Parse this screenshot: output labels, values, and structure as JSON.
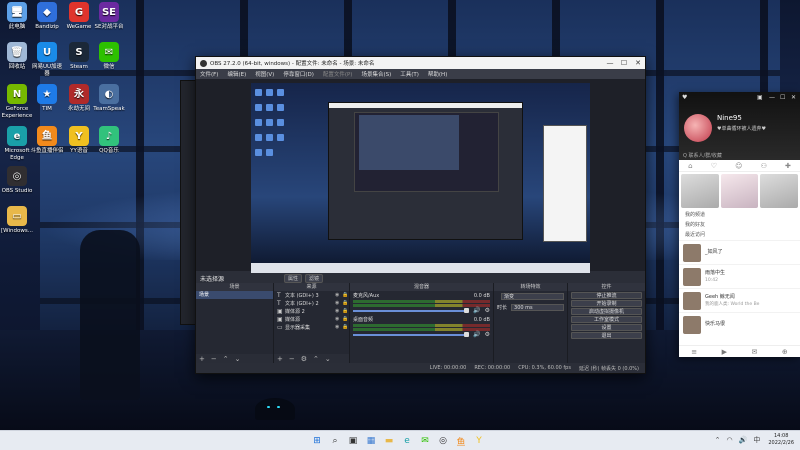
{
  "desktop": {
    "icons": [
      {
        "label": "此电脑",
        "icon": "computer-icon",
        "color": "#5ca0e8",
        "glyph": "🖥"
      },
      {
        "label": "Bandizip",
        "icon": "bandizip-icon",
        "color": "#2f6fdb",
        "glyph": "◆"
      },
      {
        "label": "WeGame",
        "icon": "wegame-icon",
        "color": "#e0342c",
        "glyph": "G"
      },
      {
        "label": "SE对战平台",
        "icon": "se-platform-icon",
        "color": "#6b2aa0",
        "glyph": "SE"
      },
      {
        "label": "回收站",
        "icon": "recycle-bin-icon",
        "color": "#9fb8d6",
        "glyph": "🗑"
      },
      {
        "label": "网易UU加速器",
        "icon": "uu-booster-icon",
        "color": "#1a8be8",
        "glyph": "U"
      },
      {
        "label": "Steam",
        "icon": "steam-icon",
        "color": "#1b2838",
        "glyph": "S"
      },
      {
        "label": "微信",
        "icon": "wechat-icon",
        "color": "#2dc100",
        "glyph": "✉"
      },
      {
        "label": "GeForce Experience",
        "icon": "geforce-icon",
        "color": "#76b900",
        "glyph": "N"
      },
      {
        "label": "TIM",
        "icon": "tim-icon",
        "color": "#1e7be8",
        "glyph": "★"
      },
      {
        "label": "永劫无间",
        "icon": "naraka-icon",
        "color": "#b02a2a",
        "glyph": "永"
      },
      {
        "label": "TeamSpeak",
        "icon": "teamspeak-icon",
        "color": "#4a6fa0",
        "glyph": "◐"
      },
      {
        "label": "Microsoft Edge",
        "icon": "edge-icon",
        "color": "#1aa0a8",
        "glyph": "e"
      },
      {
        "label": "斗鱼直播伴侣",
        "icon": "douyu-icon",
        "color": "#f28a1c",
        "glyph": "鱼"
      },
      {
        "label": "YY语音",
        "icon": "yy-voice-icon",
        "color": "#f0c020",
        "glyph": "Y"
      },
      {
        "label": "QQ音乐",
        "icon": "qq-music-icon",
        "color": "#31c27c",
        "glyph": "♪"
      },
      {
        "label": "OBS Studio",
        "icon": "obs-icon",
        "color": "#302e31",
        "glyph": "◎"
      },
      {
        "label": "[Windows...",
        "icon": "folder-icon",
        "color": "#e8b84a",
        "glyph": "▭"
      }
    ]
  },
  "obs": {
    "title": "OBS 27.2.0 (64-bit, windows) - 配置文件: 未命名 - 场景: 未命名",
    "window_buttons": [
      "—",
      "☐",
      "✕"
    ],
    "menu": [
      "文件(F)",
      "编辑(E)",
      "视图(V)",
      "停靠窗口(D)",
      "配置文件(P)",
      "场景集合(S)",
      "工具(T)",
      "帮助(H)"
    ],
    "preview_label": "未选择源",
    "filter_buttons": [
      "属性",
      "滤镜"
    ],
    "docks": {
      "scenes": {
        "header": "场景",
        "items": [
          "场景"
        ]
      },
      "sources": {
        "header": "来源",
        "items": [
          {
            "icon": "T",
            "name": "文本 (GDI+) 3"
          },
          {
            "icon": "T",
            "name": "文本 (GDI+) 2"
          },
          {
            "icon": "▣",
            "name": "媒体源 2"
          },
          {
            "icon": "▣",
            "name": "媒体源"
          },
          {
            "icon": "▭",
            "name": "显示器采集"
          }
        ]
      },
      "mixer": {
        "header": "混音器",
        "channels": [
          {
            "name": "麦克风/Aux",
            "db": "0.0 dB"
          },
          {
            "name": "桌面音频",
            "db": "0.0 dB"
          }
        ]
      },
      "transitions": {
        "header": "转场特效",
        "type_label": "渐变",
        "duration_label": "时长",
        "duration_value": "300 ms"
      },
      "controls": {
        "header": "控件",
        "buttons": [
          "停止推流",
          "开始录制",
          "启动虚拟摄像机",
          "工作室模式",
          "设置",
          "退出"
        ]
      }
    },
    "status": {
      "live": "LIVE: 00:00:00",
      "rec": "REC: 00:00:00",
      "cpu": "CPU: 0.3%, 60.00 fps",
      "extra": "延迟 (秒)  帧丢失 0 (0.0%)"
    }
  },
  "qq": {
    "window_buttons": [
      "♥",
      "▣",
      "—",
      "☐",
      "✕"
    ],
    "name": "Nine95",
    "signature": "♥单曲循环被人遗弃♥",
    "search_placeholder": "Q  联系人/群/收藏",
    "tabs": [
      "⌂",
      "♡",
      "☺",
      "⚇",
      "✚"
    ],
    "categories": [
      "我的频道",
      "我的好友",
      "最近访问"
    ],
    "contacts": [
      {
        "name": "_如风了",
        "msg": "",
        "time": "  "
      },
      {
        "name": "雨落中生",
        "msg": "",
        "time": "10:42"
      },
      {
        "name": "Geeh 鲸无闻",
        "msg": "我的鹿人类: World the Be",
        "time": "  "
      },
      {
        "name": "快乐马很",
        "msg": "",
        "time": "  "
      }
    ],
    "footer_icons": [
      "≡",
      "▶",
      "✉",
      "⊕"
    ]
  },
  "taskbar": {
    "apps": [
      {
        "icon": "windows-start-icon",
        "glyph": "⊞",
        "color": "#1a6fd8"
      },
      {
        "icon": "search-icon",
        "glyph": "⌕",
        "color": "#333"
      },
      {
        "icon": "task-view-icon",
        "glyph": "▣",
        "color": "#333"
      },
      {
        "icon": "widgets-icon",
        "glyph": "▦",
        "color": "#3a7ad0"
      },
      {
        "icon": "explorer-icon",
        "glyph": "▬",
        "color": "#e8b84a"
      },
      {
        "icon": "edge-icon",
        "glyph": "e",
        "color": "#1aa0a8"
      },
      {
        "icon": "wechat-icon",
        "glyph": "✉",
        "color": "#2dc100"
      },
      {
        "icon": "obs-icon",
        "glyph": "◎",
        "color": "#302e31"
      },
      {
        "icon": "douyu-icon",
        "glyph": "鱼",
        "color": "#f28a1c"
      },
      {
        "icon": "yy-icon",
        "glyph": "Y",
        "color": "#f0c020"
      }
    ],
    "clock_time": "14:08",
    "clock_date": "2022/2/26"
  }
}
